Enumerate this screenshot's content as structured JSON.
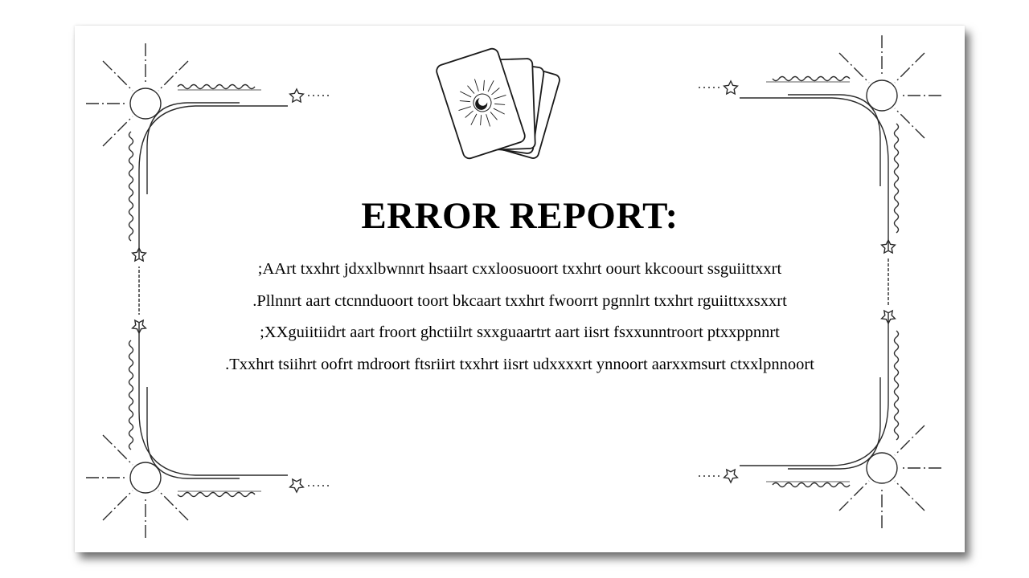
{
  "report": {
    "title": "ERROR REPORT:",
    "lines": [
      ";AArt txxhrt jdxxlbwnnrt hsaart cxxloosuoort txxhrt oourt kkcoourt ssguiittxxrt",
      ".Pllnnrt aart ctcnnduoort toort bkcaart txxhrt fwoorrt pgnnlrt txxhrt rguiittxxsxxrt",
      ";XXguiitiidrt aart froort ghctiilrt sxxguaartrt aart iisrt fsxxunntroort ptxxppnnrt",
      ".Txxhrt tsiihrt oofrt mdroort ftsriirt txxhrt iisrt udxxxxrt ynnoort aarxxmsurt ctxxlpnnoort"
    ]
  },
  "decor": {
    "header_icon": "tarot-cards-icon",
    "corner_icon": "celestial-corner-ornament-icon",
    "star_icon": "star-icon",
    "ink_color": "#2a2a2a"
  }
}
